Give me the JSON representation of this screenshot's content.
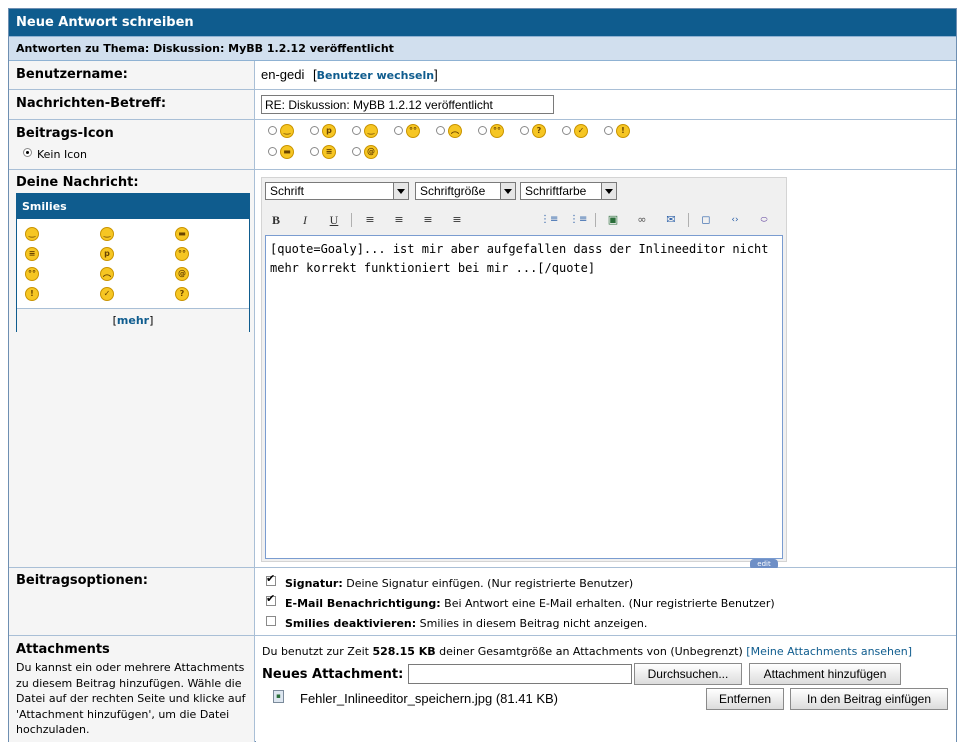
{
  "header": {
    "title": "Neue Antwort schreiben"
  },
  "thread_bar": {
    "text": "Antworten zu Thema: Diskussion: MyBB 1.2.12 veröffentlicht"
  },
  "username": {
    "label": "Benutzername:",
    "value": "en-gedi",
    "change_link": "Benutzer wechseln"
  },
  "subject": {
    "label": "Nachrichten-Betreff:",
    "value": "RE: Diskussion: MyBB 1.2.12 veröffentlicht"
  },
  "post_icon": {
    "label": "Beitrags-Icon",
    "no_icon_label": "Kein Icon",
    "icons": [
      "smile-icon",
      "wink-icon",
      "tongue-icon",
      "biggrin-icon",
      "rolleyes-icon",
      "sad-icon",
      "confused-icon",
      "question-icon",
      "angel-icon",
      "exclamation-icon",
      "cool-icon",
      "laugh-icon",
      "at-icon"
    ]
  },
  "message": {
    "label": "Deine Nachricht:",
    "smilies_title": "Smilies",
    "smilies_more": "mehr",
    "font_select": "Schrift",
    "size_select": "Schriftgröße",
    "color_select": "Schriftfarbe",
    "text": "[quote=Goaly]... ist mir aber aufgefallen dass der Inlineeditor nicht mehr korrekt funktioniert bei mir ...[/quote]",
    "edit_badge": "edit"
  },
  "options": {
    "label": "Beitragsoptionen:",
    "items": [
      {
        "bold": "Signatur:",
        "desc": "Deine Signatur einfügen. (Nur registrierte Benutzer)",
        "checked": true
      },
      {
        "bold": "E-Mail Benachrichtigung:",
        "desc": "Bei Antwort eine E-Mail erhalten. (Nur registrierte Benutzer)",
        "checked": true
      },
      {
        "bold": "Smilies deaktivieren:",
        "desc": "Smilies in diesem Beitrag nicht anzeigen.",
        "checked": false
      }
    ]
  },
  "attachments": {
    "label": "Attachments",
    "help": "Du kannst ein oder mehrere Attachments zu diesem Beitrag hinzufügen. Wähle die Datei auf der rechten Seite und klicke auf 'Attachment hinzufügen', um die Datei hochzuladen.",
    "usage_prefix": "Du benutzt zur Zeit",
    "usage_value": "528.15 KB",
    "usage_suffix": "deiner Gesamtgröße an Attachments von (Unbegrenzt)",
    "view_link": "[Meine Attachments ansehen]",
    "new_label": "Neues Attachment:",
    "browse_button": "Durchsuchen...",
    "add_button": "Attachment hinzufügen",
    "file_name": "Fehler_Inlineeditor_speichern.jpg (81.41 KB)",
    "remove_button": "Entfernen",
    "insert_button": "In den Beitrag einfügen"
  }
}
